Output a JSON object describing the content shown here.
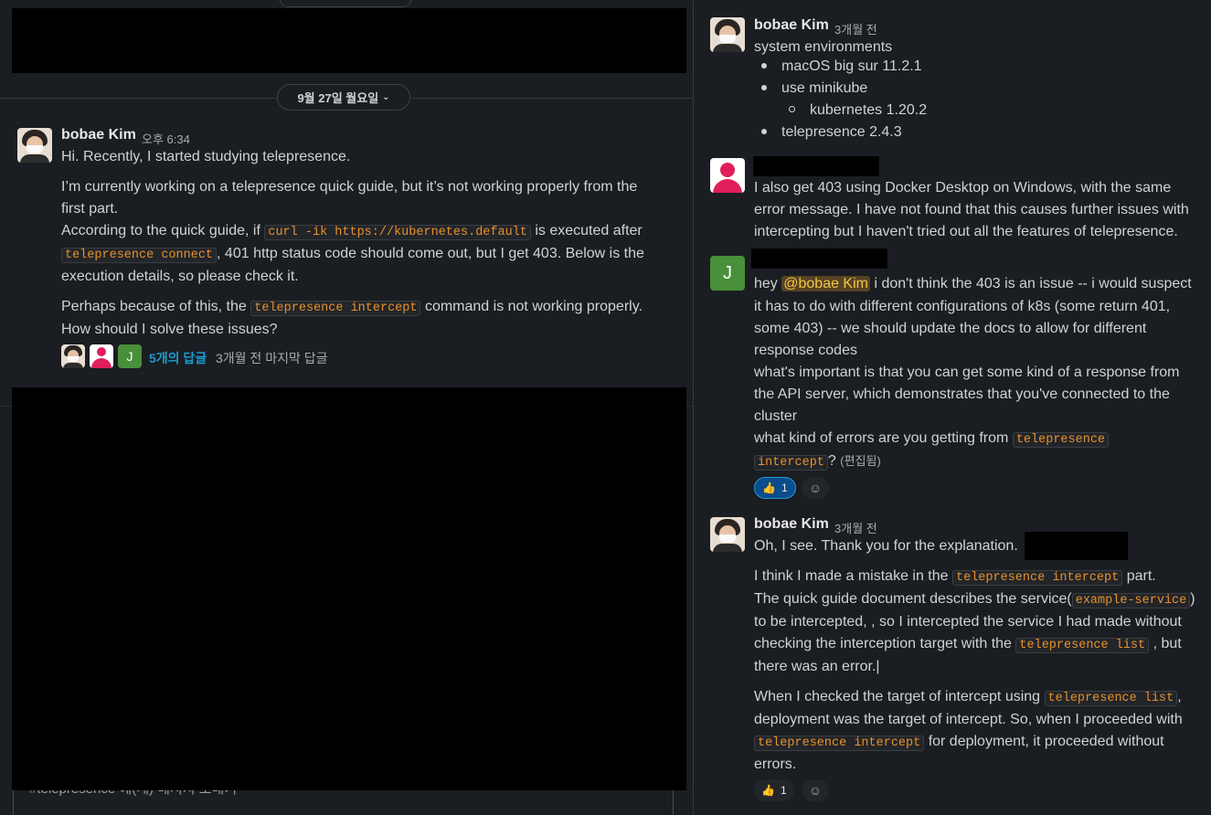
{
  "left": {
    "date_divider": "9월 27일 월요일",
    "message": {
      "author": "bobae Kim",
      "time": "오후 6:34",
      "p1": "Hi. Recently, I started studying telepresence.",
      "p2a": "I’m currently working on a telepresence quick guide, but it’s not working properly from the",
      "p2b": "first part.",
      "p3a": "According to the quick guide, if",
      "p3_code1": "curl -ik https://kubernetes.default",
      "p3b": "is executed after",
      "p3_code2": "telepresence connect",
      "p3c": ", 401 http status code should come out, but I get 403. Below is the",
      "p3d": "execution details, so please check it.",
      "p4a": "Perhaps because of this, the",
      "p4_code": "telepresence intercept",
      "p4b": "command is not working properly.",
      "p5": "How should I solve these issues?",
      "reply_count": "5개의 답글",
      "reply_meta": "3개월 전 마지막 답글"
    },
    "composer_text": "#telepresence 에(게) 메시지 보내기"
  },
  "right": {
    "msg1": {
      "author": "bobae Kim",
      "time": "3개월 전",
      "line": "system environments",
      "b1": "macOS big sur 11.2.1",
      "b2": "use minikube",
      "b2a": "kubernetes 1.20.2",
      "b3": "telepresence 2.4.3"
    },
    "msg2": {
      "l1": "I also get 403 using Docker Desktop on Windows, with the same",
      "l2": "error message. I have not found that this causes further issues with",
      "l3": "intercepting but I haven't tried out all the features of telepresence."
    },
    "msg3": {
      "avatar_letter": "J",
      "l1a": "hey",
      "mention": "@bobae Kim",
      "l1b": "i don't think the 403 is an issue -- i would suspect",
      "l2": "it has to do with different configurations of k8s (some return 401,",
      "l3": "some 403) -- we should update the docs to allow for different",
      "l4": "response codes",
      "l5": "what's important is that you can get some kind of a response from",
      "l6": "the API server, which demonstrates that you've connected to the",
      "l7": "cluster",
      "l8a": "what kind of errors are you getting from",
      "l8_code": "telepresence",
      "l9_code": "intercept",
      "l9b": "?",
      "edited": "(편집됨)",
      "reaction_emoji": "👍",
      "reaction_count": "1"
    },
    "msg4": {
      "author": "bobae Kim",
      "time": "3개월 전",
      "l1": "Oh, I see. Thank you for the explanation.",
      "l2a": "I think I made a mistake in the",
      "l2_code": "telepresence intercept",
      "l2b": "part.",
      "l3a": "The quick guide document describes the service(",
      "l3_code": "example-service",
      "l3b": ")",
      "l4": "to be intercepted, , so I intercepted the service I had made without",
      "l5a": "checking the interception target with the",
      "l5_code": "telepresence list",
      "l5b": ", but",
      "l6": "there was an error.|",
      "l7a": "When I checked the target of intercept using",
      "l7_code": "telepresence list",
      "l7b": ",",
      "l8": "deployment was the target of intercept. So, when I proceeded with",
      "l9_code": "telepresence intercept",
      "l9b": "for deployment, it proceeded without",
      "l10": "errors.",
      "reaction_emoji": "👍",
      "reaction_count": "1"
    }
  }
}
